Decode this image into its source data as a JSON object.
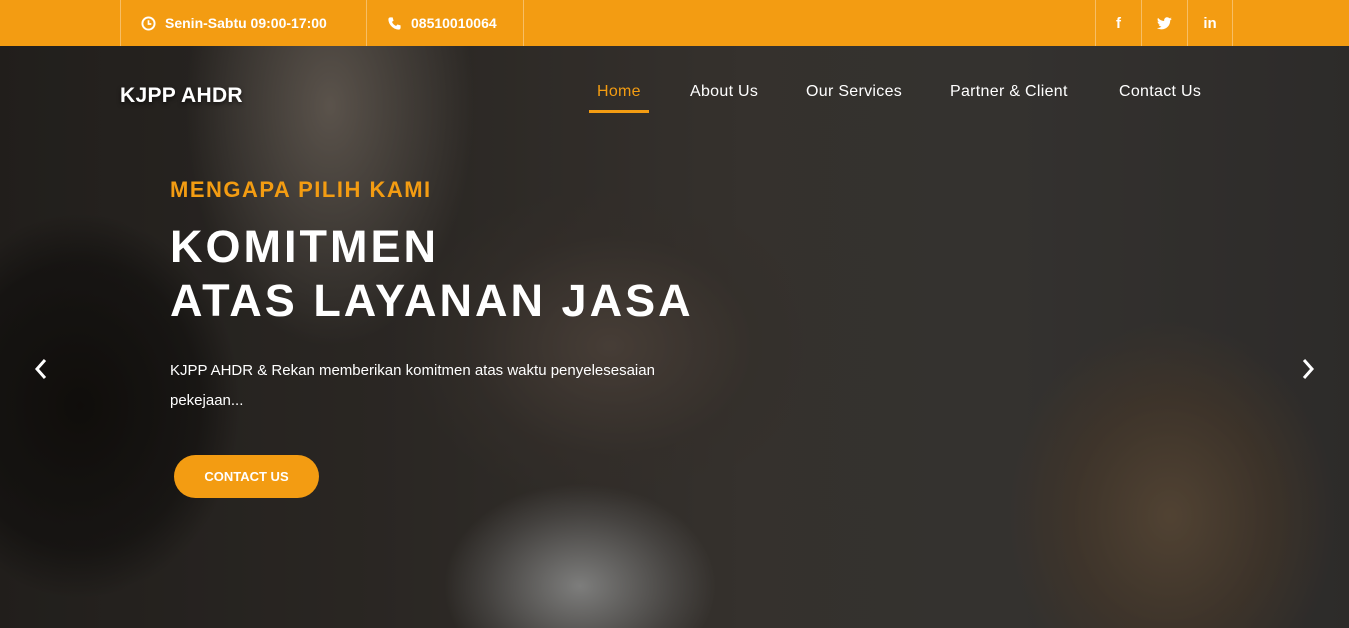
{
  "topbar": {
    "hours": "Senin-Sabtu 09:00-17:00",
    "phone": "08510010064",
    "social": {
      "facebook": "f",
      "twitter": "twitter-icon",
      "linkedin": "in"
    },
    "color": "#f39c12"
  },
  "brand": "KJPP AHDR",
  "nav": {
    "items": [
      "Home",
      "About Us",
      "Our Services",
      "Partner & Client",
      "Contact Us"
    ],
    "active": "Home",
    "active_color": "#f39c12"
  },
  "hero": {
    "kicker": "MENGAPA PILIH KAMI",
    "headline_line1": "KOMITMEN",
    "headline_line2": "ATAS LAYANAN JASA",
    "description_line1": "KJPP AHDR & Rekan memberikan komitmen atas waktu penyelesesaian",
    "description_line2": "pekejaan...",
    "cta_label": "CONTACT US"
  },
  "icons": {
    "hours": "clock-icon",
    "phone": "phone-icon",
    "prev": "chevron-left-icon",
    "next": "chevron-right-icon"
  }
}
